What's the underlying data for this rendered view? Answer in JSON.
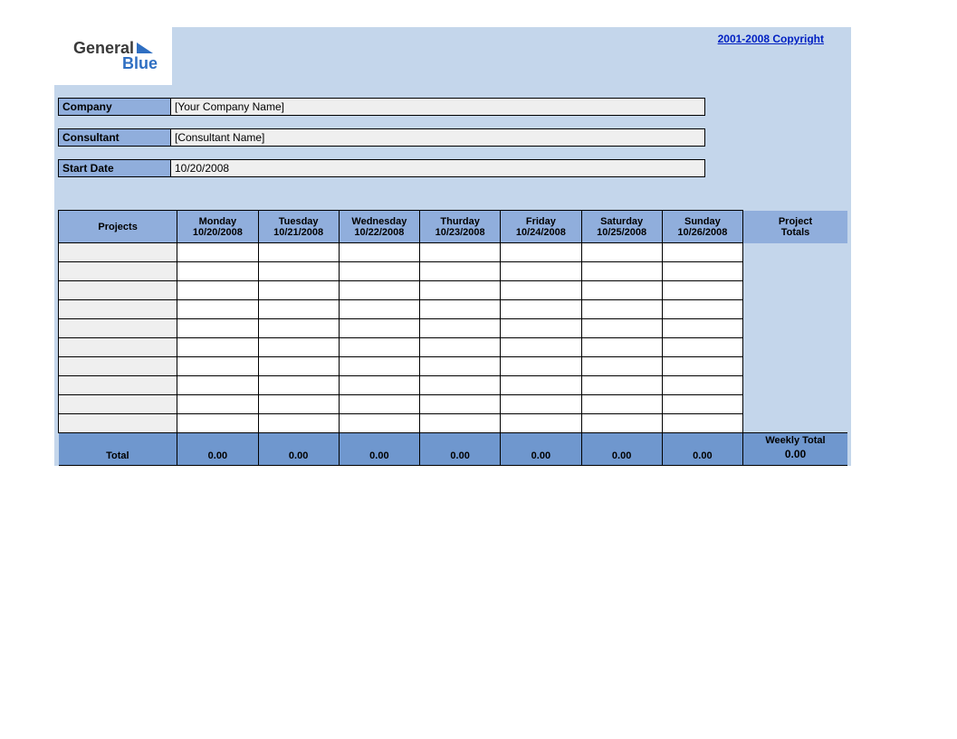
{
  "logo": {
    "line1": "General",
    "line2": "Blue"
  },
  "copyright_text": "2001-2008 Copyright",
  "meta": {
    "company_label": "Company",
    "company_value": "[Your Company Name]",
    "consultant_label": "Consultant",
    "consultant_value": "[Consultant Name]",
    "startdate_label": "Start Date",
    "startdate_value": "10/20/2008"
  },
  "table": {
    "headers": {
      "projects": "Projects",
      "days": [
        {
          "name": "Monday",
          "date": "10/20/2008"
        },
        {
          "name": "Tuesday",
          "date": "10/21/2008"
        },
        {
          "name": "Wednesday",
          "date": "10/22/2008"
        },
        {
          "name": "Thurday",
          "date": "10/23/2008"
        },
        {
          "name": "Friday",
          "date": "10/24/2008"
        },
        {
          "name": "Saturday",
          "date": "10/25/2008"
        },
        {
          "name": "Sunday",
          "date": "10/26/2008"
        }
      ],
      "project_totals_l1": "Project",
      "project_totals_l2": "Totals"
    },
    "rows": [
      {
        "label": "",
        "cells": [
          "",
          "",
          "",
          "",
          "",
          "",
          ""
        ],
        "total": ""
      },
      {
        "label": "",
        "cells": [
          "",
          "",
          "",
          "",
          "",
          "",
          ""
        ],
        "total": ""
      },
      {
        "label": "",
        "cells": [
          "",
          "",
          "",
          "",
          "",
          "",
          ""
        ],
        "total": ""
      },
      {
        "label": "",
        "cells": [
          "",
          "",
          "",
          "",
          "",
          "",
          ""
        ],
        "total": ""
      },
      {
        "label": "",
        "cells": [
          "",
          "",
          "",
          "",
          "",
          "",
          ""
        ],
        "total": ""
      },
      {
        "label": "",
        "cells": [
          "",
          "",
          "",
          "",
          "",
          "",
          ""
        ],
        "total": ""
      },
      {
        "label": "",
        "cells": [
          "",
          "",
          "",
          "",
          "",
          "",
          ""
        ],
        "total": ""
      },
      {
        "label": "",
        "cells": [
          "",
          "",
          "",
          "",
          "",
          "",
          ""
        ],
        "total": ""
      },
      {
        "label": "",
        "cells": [
          "",
          "",
          "",
          "",
          "",
          "",
          ""
        ],
        "total": ""
      },
      {
        "label": "",
        "cells": [
          "",
          "",
          "",
          "",
          "",
          "",
          ""
        ],
        "total": ""
      }
    ],
    "footer": {
      "total_label": "Total",
      "day_totals": [
        "0.00",
        "0.00",
        "0.00",
        "0.00",
        "0.00",
        "0.00",
        "0.00"
      ],
      "weekly_total_label": "Weekly Total",
      "weekly_total_value": "0.00"
    }
  }
}
